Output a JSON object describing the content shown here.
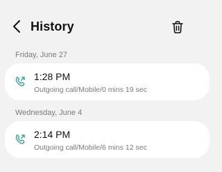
{
  "header": {
    "title": "History",
    "back_icon": "chevron-left-icon",
    "delete_icon": "trash-icon"
  },
  "entries": [
    {
      "date": "Friday, June 27",
      "time": "1:28 PM",
      "detail": "Outgoing call/Mobile/0 mins 19 sec",
      "icon": "outgoing-call-icon"
    },
    {
      "date": "Wednesday, June 4",
      "time": "2:14 PM",
      "detail": "Outgoing call/Mobile/6 mins 12 sec",
      "icon": "outgoing-call-icon"
    }
  ],
  "colors": {
    "background": "#f2f2f2",
    "card": "#ffffff",
    "call_icon": "#2a9d8f",
    "secondary_text": "#7a7a7a"
  }
}
